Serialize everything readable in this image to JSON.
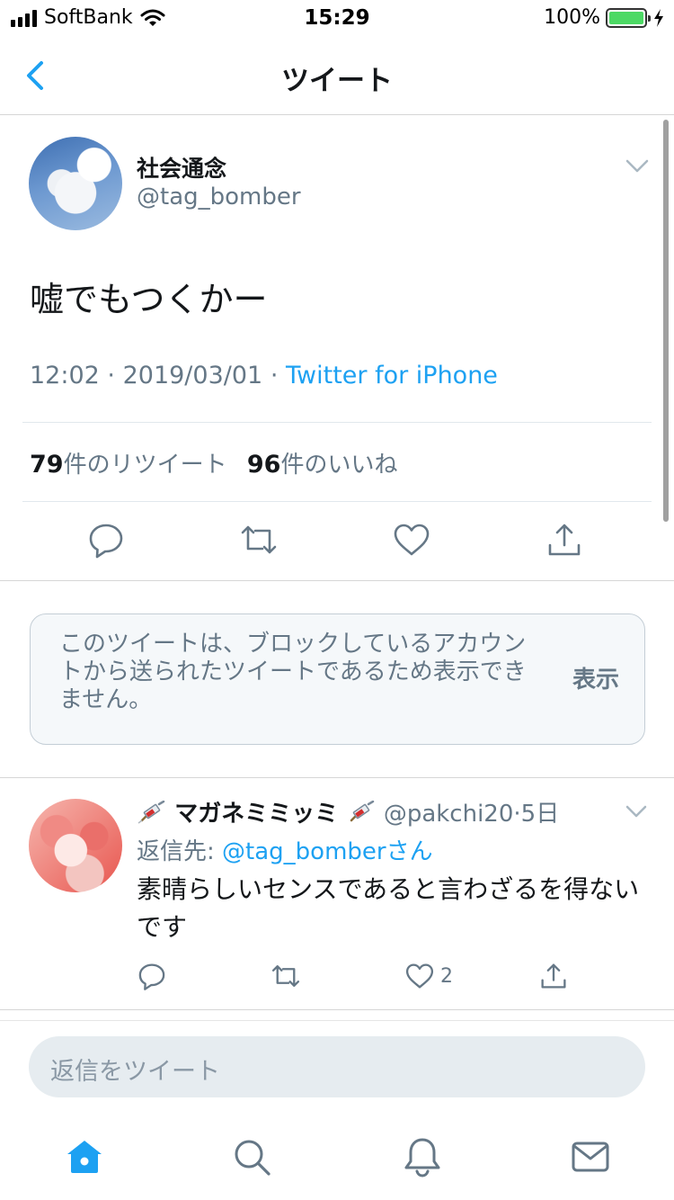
{
  "status_bar": {
    "carrier": "SoftBank",
    "time": "15:29",
    "battery": "100%",
    "battery_level": 1.0,
    "icons": [
      "signal-bars-icon",
      "wifi-icon",
      "battery-icon",
      "charging-bolt-icon"
    ]
  },
  "nav": {
    "title": "ツイート",
    "back_icon": "chevron-left-icon"
  },
  "tweet": {
    "display_name": "社会通念",
    "handle": "@tag_bomber",
    "text": "嘘でもつくかー",
    "time": "12:02",
    "date": "2019/03/01",
    "separator": "·",
    "source": "Twitter for iPhone",
    "retweet_count": "79",
    "retweet_label": "件のリツイート",
    "like_count": "96",
    "like_label": "件のいいね",
    "actions": [
      "reply-icon",
      "retweet-icon",
      "like-icon",
      "share-icon"
    ]
  },
  "blocked": {
    "message": "このツイートは、ブロックしているアカウントから送られたツイートであるため表示できません。",
    "show_label": "表示"
  },
  "reply": {
    "display_name": "マガネミミッミ",
    "name_emoji": "syringe-emoji",
    "handle": "@pakchi20",
    "age": "5日",
    "separator": "·",
    "reply_prefix": "返信先: ",
    "reply_mention": "@tag_bomber",
    "reply_suffix": "さん",
    "text": "素晴らしいセンスであると言わざるを得ないです",
    "like_count": "2"
  },
  "composer": {
    "placeholder": "返信をツイート"
  },
  "tabbar": {
    "items": [
      "home-icon",
      "search-icon",
      "notifications-icon",
      "messages-icon"
    ]
  },
  "colors": {
    "accent": "#1da1f2",
    "secondary_text": "#657786",
    "divider": "#e1e8ed",
    "battery": "#4cd964",
    "composer_bg": "#e6ecf0"
  }
}
